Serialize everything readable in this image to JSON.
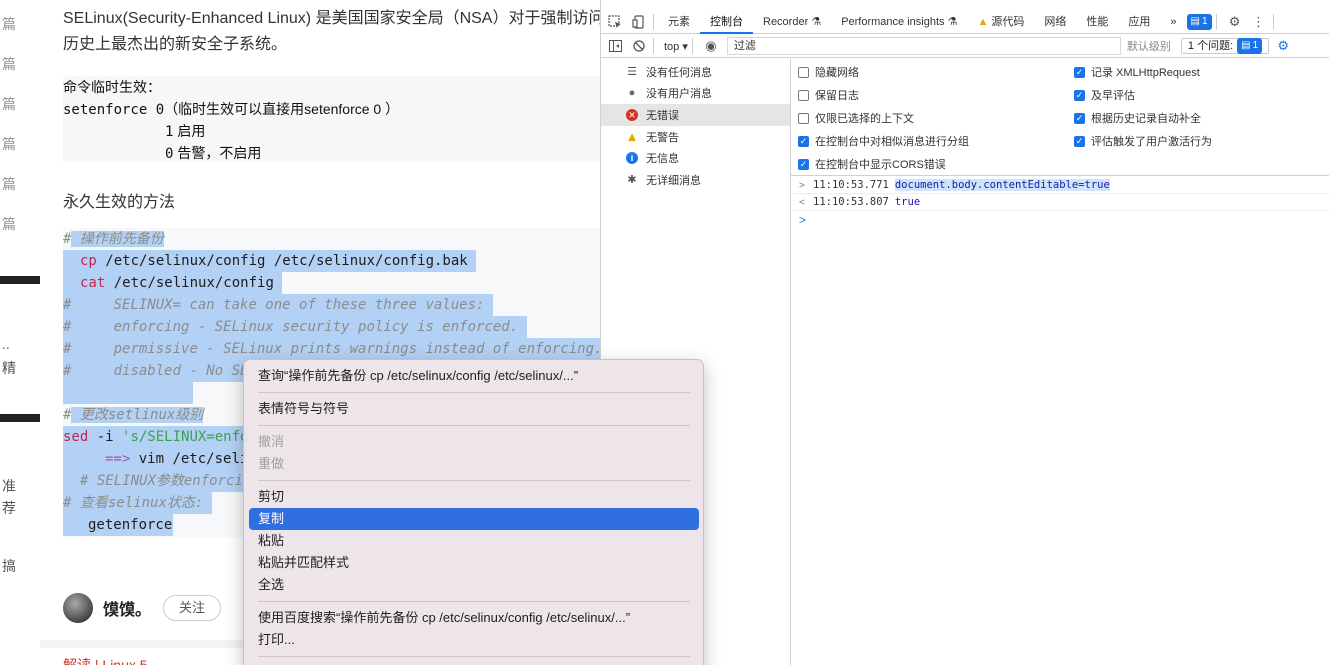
{
  "blog": {
    "sidebar_items": [
      "篇",
      "篇",
      "篇",
      "篇",
      "篇",
      "篇"
    ],
    "sidebar_fragments": [
      "..",
      "精",
      "准",
      "荐",
      "搞"
    ],
    "intro_line1": "SELinux(Security-Enhanced Linux) 是美国国家安全局（NSA）对于强制访问",
    "intro_line2": "历史上最杰出的新安全子系统。",
    "cmd_title": "命令临时生效：",
    "cmd_line2_code": "setenforce 0",
    "cmd_line2_note": "（临时生效可以直接用setenforce 0 ）",
    "cmd_line3_num": "1",
    "cmd_line3_label": "启用",
    "cmd_line4_num": "0",
    "cmd_line4_label": "告警，不启用",
    "permanent_heading": "永久生效的方法",
    "code_lines": [
      {
        "hash": "#",
        "text": " 操作前先备份"
      },
      {
        "kw": "cp",
        "text": " /etc/selinux/config /etc/selinux/config.bak"
      },
      {
        "kw": "cat",
        "text": " /etc/selinux/config"
      },
      {
        "hash": "#",
        "text": "     SELINUX= can take one of these three values:"
      },
      {
        "hash": "#",
        "text": "     enforcing - SELinux security policy is enforced."
      },
      {
        "hash": "#",
        "text": "     permissive - SELinux prints warnings instead of enforcing."
      },
      {
        "hash": "#",
        "text": "     disabled - No SE"
      },
      {
        "text": ""
      },
      {
        "hash": "#",
        "text": " 更改setlinux级别"
      },
      {
        "kw": "sed",
        "text": " -i ",
        "str": "'s/SELINUX=enfo"
      },
      {
        "arrow": "==>",
        "text": " vim /etc/seli"
      },
      {
        "hash": "#",
        "text": " SELINUX参数enforci"
      },
      {
        "hash": "#",
        "text": " 查看selinux状态:"
      },
      {
        "text": "getenforce"
      }
    ],
    "author_name": "馍馍。",
    "follow_label": "关注",
    "bottom_link": "解读 | Linux 5"
  },
  "devtools": {
    "tabs": [
      "元素",
      "控制台",
      "Recorder",
      "Performance insights",
      "源代码",
      "网络",
      "性能",
      "应用"
    ],
    "active_tab": "控制台",
    "more_tabs": "»",
    "issues_badge_count": "1",
    "context_select": "top",
    "filter_placeholder": "过滤",
    "levels_label": "默认级别",
    "issues_label": "1 个问题:",
    "issues_count": "1",
    "sidebar": [
      {
        "icon": "list-icon",
        "glyph": "☰",
        "label": "没有任何消息"
      },
      {
        "icon": "user-icon",
        "glyph": "●",
        "label": "没有用户消息"
      },
      {
        "icon": "error-icon",
        "glyph": "✕",
        "label": "无错误"
      },
      {
        "icon": "warning-icon",
        "glyph": "▲",
        "label": "无警告"
      },
      {
        "icon": "info-icon",
        "glyph": "i",
        "label": "无信息"
      },
      {
        "icon": "verbose-icon",
        "glyph": "✱",
        "label": "无详细消息"
      }
    ],
    "settings_left": [
      {
        "label": "隐藏网络",
        "checked": false
      },
      {
        "label": "保留日志",
        "checked": false
      },
      {
        "label": "仅限已选择的上下文",
        "checked": false
      },
      {
        "label": "在控制台中对相似消息进行分组",
        "checked": true
      },
      {
        "label": "在控制台中显示CORS错误",
        "checked": true
      }
    ],
    "settings_right": [
      {
        "label": "记录 XMLHttpRequest",
        "checked": true
      },
      {
        "label": "及早评估",
        "checked": true
      },
      {
        "label": "根据历史记录自动补全",
        "checked": true
      },
      {
        "label": "评估触发了用户激活行为",
        "checked": true
      }
    ],
    "log": [
      {
        "arrow": ">",
        "time": "11:10:53.771",
        "code": "document.body.contentEditable=true"
      },
      {
        "arrow": "<",
        "time": "11:10:53.807",
        "code": "true"
      }
    ],
    "prompt": ">"
  },
  "context_menu": {
    "lookup": "查询“操作前先备份   cp /etc/selinux/config /etc/selinux/...”",
    "emoji": "表情符号与符号",
    "undo": "撤消",
    "redo": "重做",
    "cut": "剪切",
    "copy": "复制",
    "paste": "粘贴",
    "paste_match": "粘贴并匹配样式",
    "select_all": "全选",
    "baidu_search": "使用百度搜索“操作前先备份   cp /etc/selinux/config /etc/selinux/...”",
    "print": "打印..."
  },
  "colors": {
    "accent": "#1a73e8",
    "selection": "#b3d1f5",
    "menu_highlight": "#2f6fe0"
  }
}
